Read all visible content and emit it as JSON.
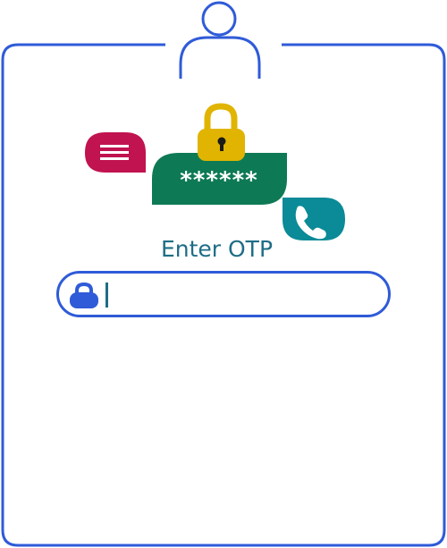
{
  "otp_prompt": {
    "masked_code": "******",
    "title": "Enter OTP"
  },
  "otp_input": {
    "value": "",
    "placeholder": ""
  },
  "icons": {
    "user": "user-icon",
    "lock": "padlock-icon",
    "message": "message-bubble-icon",
    "phone": "phone-bubble-icon",
    "input_lock": "input-lock-icon"
  },
  "colors": {
    "frame_blue": "#2f5bd8",
    "title_teal": "#1e6d86",
    "bubble_green": "#0e7a55",
    "bubble_crimson": "#c0134f",
    "bubble_teal": "#0b8a97",
    "lock_gold": "#e0b400"
  }
}
